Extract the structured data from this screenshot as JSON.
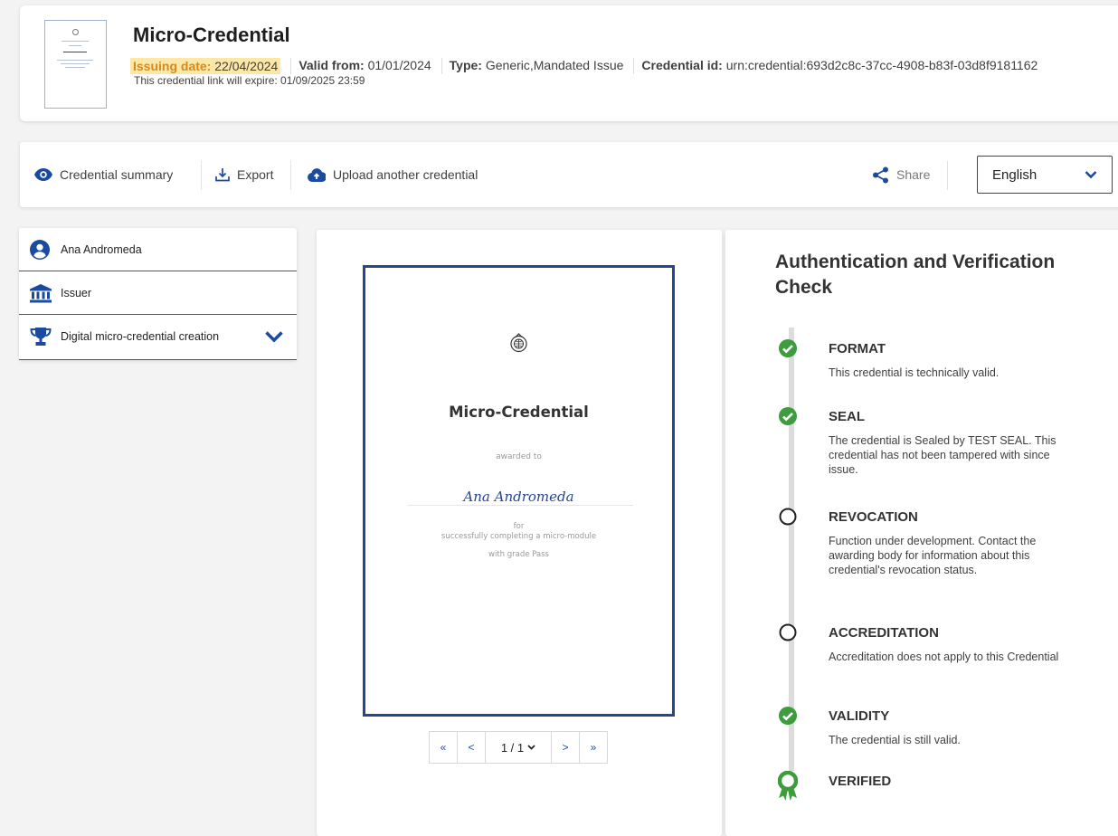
{
  "header": {
    "title": "Micro-Credential",
    "issuing_date_label": "Issuing date:",
    "issuing_date": "22/04/2024",
    "valid_from_label": "Valid from:",
    "valid_from": "01/01/2024",
    "type_label": "Type:",
    "type": "Generic,Mandated Issue",
    "credential_id_label": "Credential id:",
    "credential_id": "urn:credential:693d2c8c-37cc-4908-b83f-03d8f9181162",
    "expire_text": "This credential link will expire: 01/09/2025 23:59"
  },
  "toolbar": {
    "summary_label": "Credential summary",
    "export_label": "Export",
    "upload_label": "Upload another credential",
    "share_label": "Share",
    "language": "English"
  },
  "sidebar": {
    "items": [
      {
        "label": "Ana Andromeda",
        "icon": "user-circle-icon"
      },
      {
        "label": "Issuer",
        "icon": "institution-icon"
      },
      {
        "label": "Digital micro-credential creation",
        "icon": "trophy-icon"
      }
    ]
  },
  "document": {
    "title": "Micro-Credential",
    "awarded_to": "awarded to",
    "name": "Ana Andromeda",
    "for": "for",
    "reason": "successfully completing a micro-module",
    "grade": "with grade Pass"
  },
  "pager": {
    "first": "«",
    "prev": "<",
    "current": "1 / 1",
    "next": ">",
    "last": "»"
  },
  "verification": {
    "title": "Authentication and Verification Check",
    "colors": {
      "ok": "#3d9c3c",
      "pending": "#222222",
      "line": "#dcdcdc"
    },
    "steps": [
      {
        "heading": "FORMAT",
        "text": "This credential is technically valid.",
        "status": "ok"
      },
      {
        "heading": "SEAL",
        "text": "The credential is Sealed by TEST SEAL. This credential has not been tampered with since issue.",
        "status": "ok"
      },
      {
        "heading": "REVOCATION",
        "text": "Function under development. Contact the awarding body for information about this credential's revocation status.",
        "status": "pending"
      },
      {
        "heading": "ACCREDITATION",
        "text": "Accreditation does not apply to this Credential",
        "status": "pending"
      },
      {
        "heading": "VALIDITY",
        "text": "The credential is still valid.",
        "status": "ok"
      },
      {
        "heading": "VERIFIED",
        "text": "",
        "status": "award"
      }
    ]
  }
}
